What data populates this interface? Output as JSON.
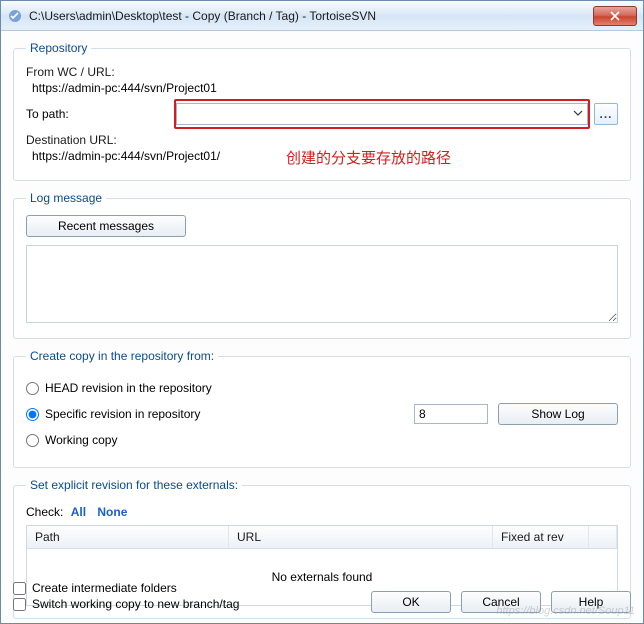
{
  "window": {
    "title": "C:\\Users\\admin\\Desktop\\test - Copy (Branch / Tag) - TortoiseSVN",
    "close": "×"
  },
  "repository": {
    "legend": "Repository",
    "from_label": "From WC / URL:",
    "from_value": "https://admin-pc:444/svn/Project01",
    "to_label": "To path:",
    "to_value": "",
    "browse": "...",
    "dest_label": "Destination URL:",
    "dest_value": "https://admin-pc:444/svn/Project01/",
    "annotation": "创建的分支要存放的路径"
  },
  "log": {
    "legend": "Log message",
    "recent": "Recent messages",
    "text": ""
  },
  "source": {
    "legend": "Create copy in the repository from:",
    "opt_head": "HEAD revision in the repository",
    "opt_specific": "Specific revision in repository",
    "opt_wc": "Working copy",
    "rev_value": "8",
    "showlog": "Show Log"
  },
  "externals": {
    "legend": "Set explicit revision for these externals:",
    "check_label": "Check:",
    "all": "All",
    "none": "None",
    "col_path": "Path",
    "col_url": "URL",
    "col_fixed": "Fixed at rev",
    "empty": "No externals found"
  },
  "options": {
    "intermediate": "Create intermediate folders",
    "switch": "Switch working copy to new branch/tag"
  },
  "buttons": {
    "ok": "OK",
    "cancel": "Cancel",
    "help": "Help"
  },
  "watermark": "https://blog.csdn.net/Soup11"
}
